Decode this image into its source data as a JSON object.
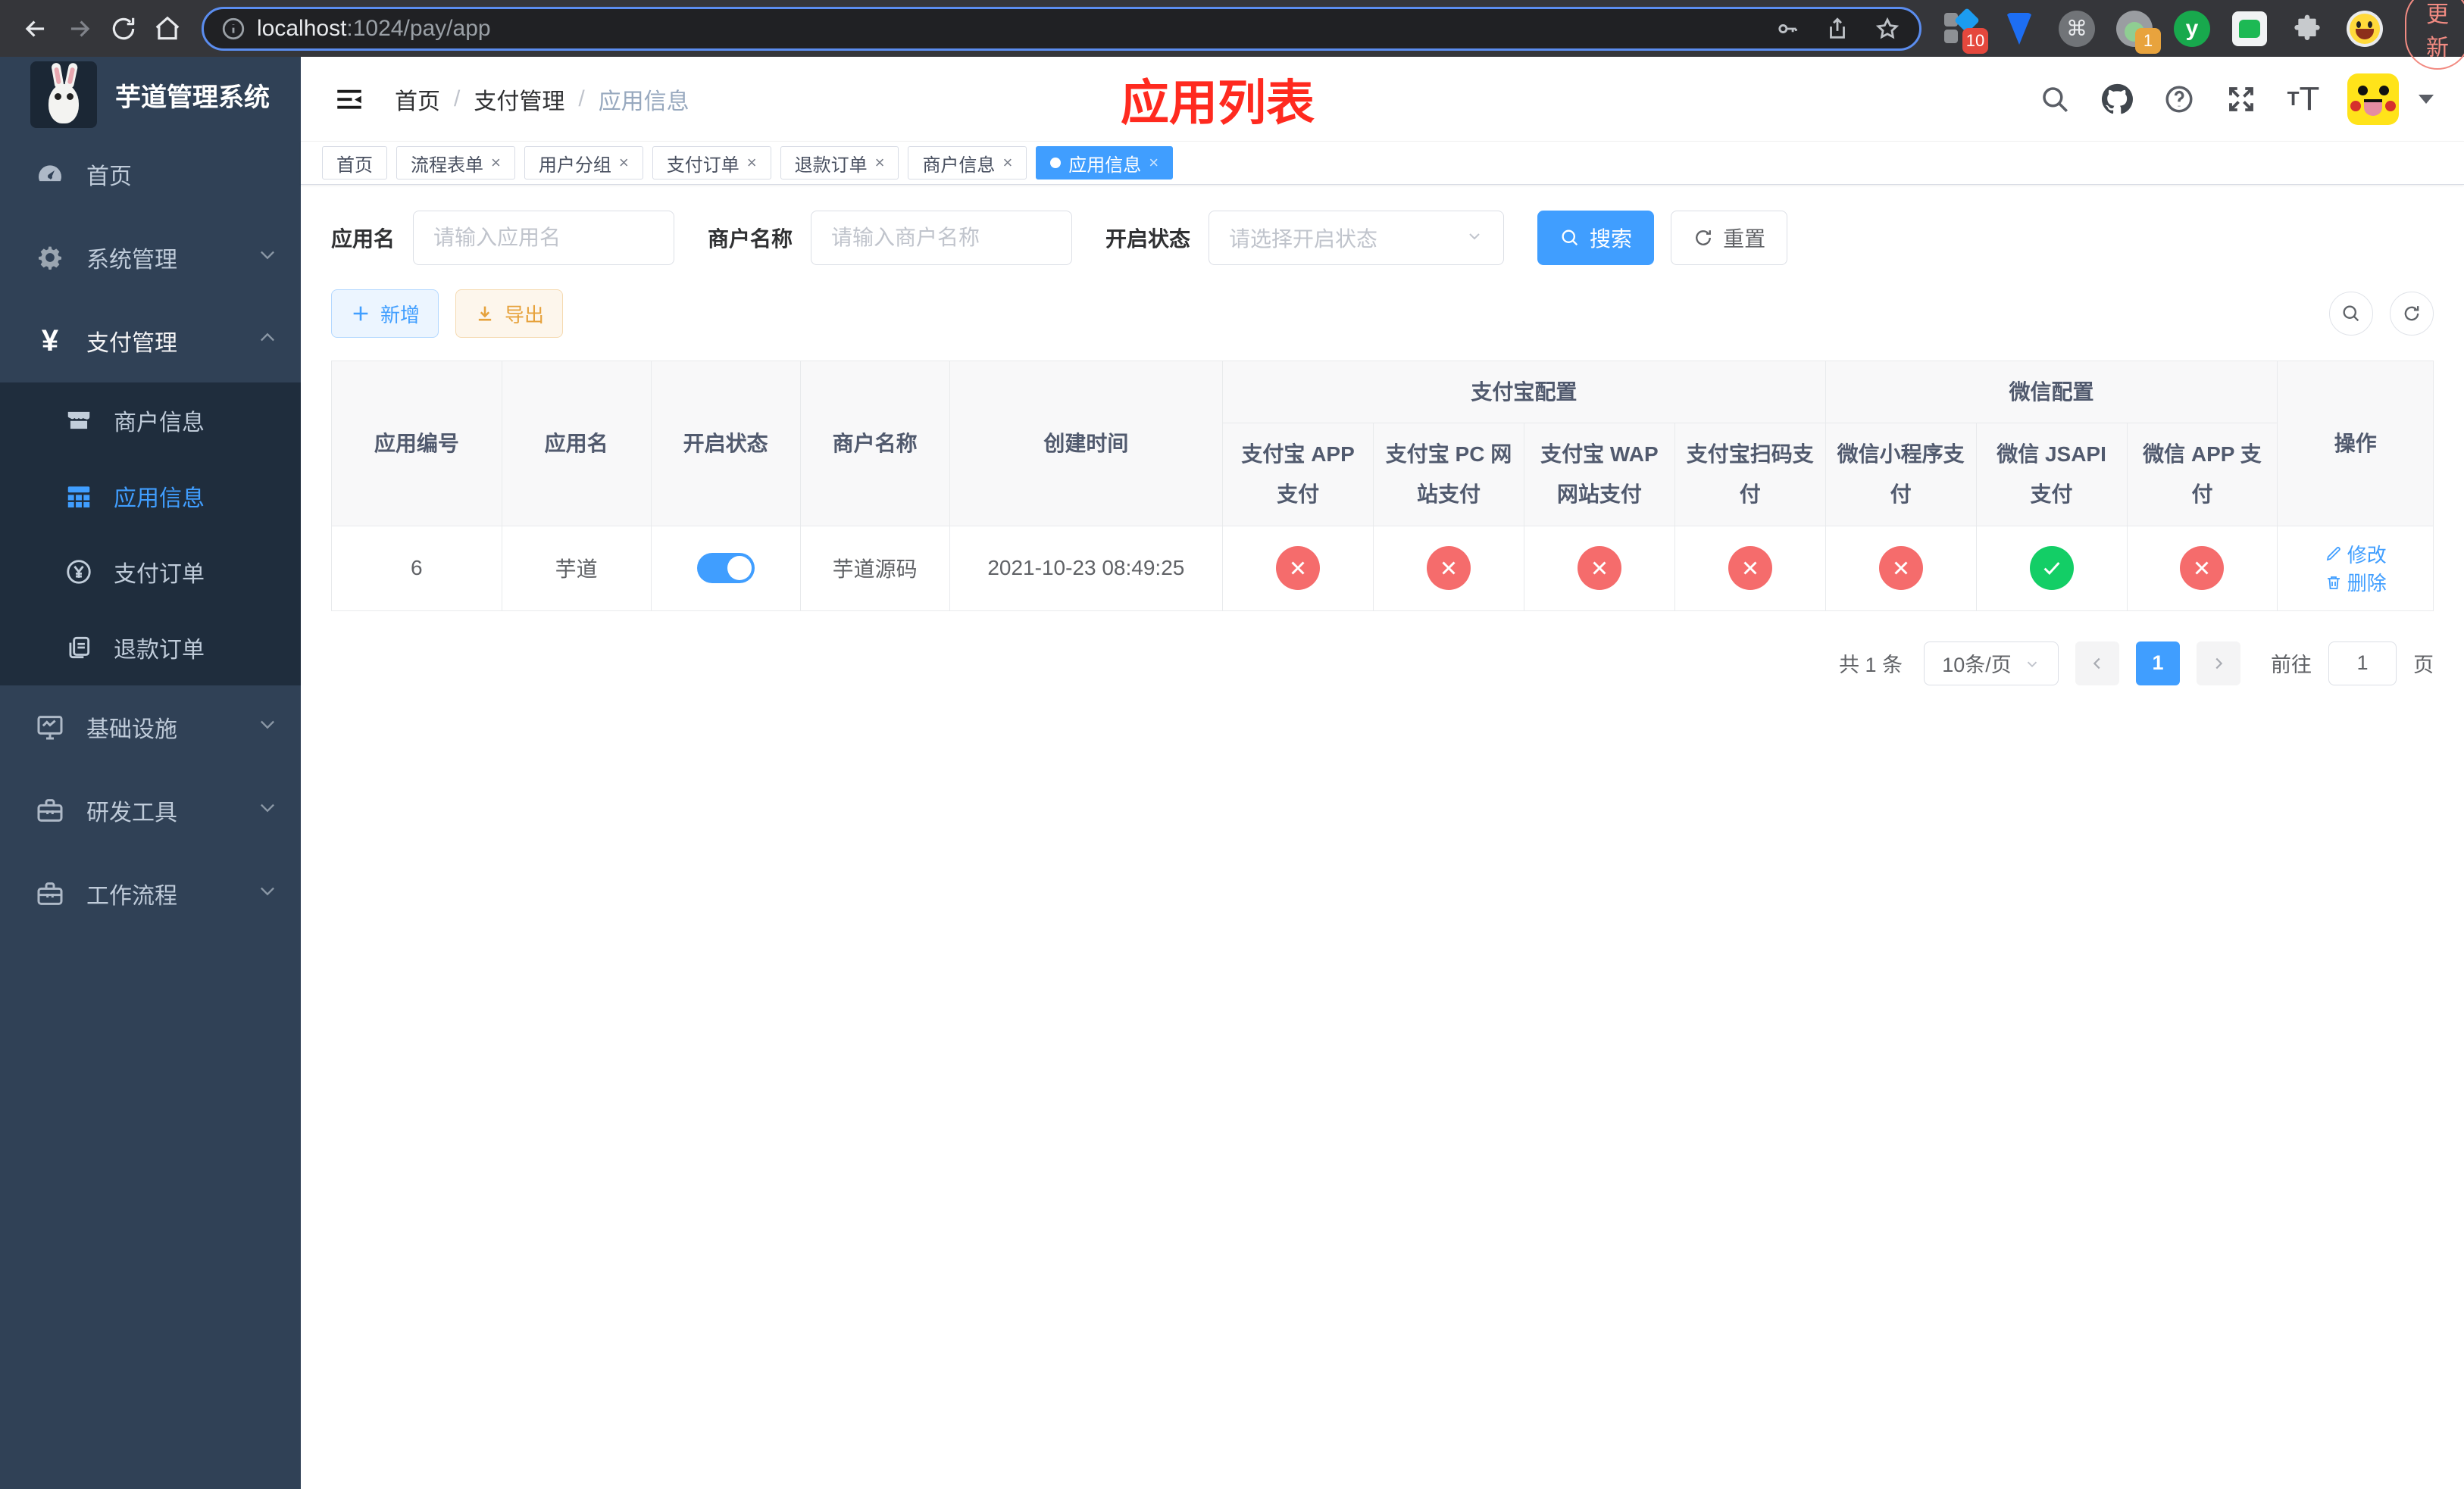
{
  "glyphs": {
    "close": "×",
    "cmd": "⌘",
    "gear": "⚙",
    "yen": "¥"
  },
  "browser": {
    "url_host": "localhost",
    "url_rest": ":1024/pay/app",
    "update_label": "更新",
    "ext_grid_badge": "10",
    "ext_avatar_badge": "1",
    "ext_y_label": "y"
  },
  "sidebar": {
    "logo_title": "芋道管理系统",
    "items": [
      {
        "label": "首页"
      },
      {
        "label": "系统管理"
      },
      {
        "label": "支付管理"
      },
      {
        "label": "基础设施"
      },
      {
        "label": "研发工具"
      },
      {
        "label": "工作流程"
      }
    ],
    "submenu": [
      {
        "label": "商户信息"
      },
      {
        "label": "应用信息"
      },
      {
        "label": "支付订单"
      },
      {
        "label": "退款订单"
      }
    ]
  },
  "header": {
    "breadcrumb": [
      "首页",
      "支付管理",
      "应用信息"
    ],
    "separator": "/",
    "annotation": "应用列表"
  },
  "tabs": [
    {
      "label": "首页",
      "closable": false,
      "active": false
    },
    {
      "label": "流程表单",
      "closable": true,
      "active": false
    },
    {
      "label": "用户分组",
      "closable": true,
      "active": false
    },
    {
      "label": "支付订单",
      "closable": true,
      "active": false
    },
    {
      "label": "退款订单",
      "closable": true,
      "active": false
    },
    {
      "label": "商户信息",
      "closable": true,
      "active": false
    },
    {
      "label": "应用信息",
      "closable": true,
      "active": true
    }
  ],
  "filter": {
    "app_name_label": "应用名",
    "app_name_placeholder": "请输入应用名",
    "merchant_label": "商户名称",
    "merchant_placeholder": "请输入商户名称",
    "status_label": "开启状态",
    "status_placeholder": "请选择开启状态",
    "search_label": "搜索",
    "reset_label": "重置"
  },
  "toolbar": {
    "add_label": "新增",
    "export_label": "导出"
  },
  "table": {
    "head": {
      "app_id": "应用编号",
      "app_name": "应用名",
      "status": "开启状态",
      "merchant": "商户名称",
      "create_time": "创建时间",
      "alipay_group": "支付宝配置",
      "wechat_group": "微信配置",
      "actions": "操作",
      "channels": [
        "支付宝 APP 支付",
        "支付宝 PC 网站支付",
        "支付宝 WAP 网站支付",
        "支付宝扫码支付",
        "微信小程序支付",
        "微信 JSAPI 支付",
        "微信 APP 支付"
      ]
    },
    "rows": [
      {
        "app_id": "6",
        "app_name": "芋道",
        "status_on": true,
        "merchant": "芋道源码",
        "create_time": "2021-10-23 08:49:25",
        "channels": [
          "closed",
          "closed",
          "closed",
          "closed",
          "closed",
          "open",
          "closed"
        ],
        "edit_label": "修改",
        "delete_label": "删除"
      }
    ]
  },
  "pagination": {
    "total": "共 1 条",
    "page_size": "10条/页",
    "current_page": "1",
    "goto_label": "前往",
    "goto_value": "1",
    "page_suffix": "页"
  },
  "colors": {
    "accent": "#409EFF",
    "success": "#13ce66",
    "danger": "#f56c6c",
    "warning": "#e6a23c",
    "sidebar": "#304156"
  }
}
